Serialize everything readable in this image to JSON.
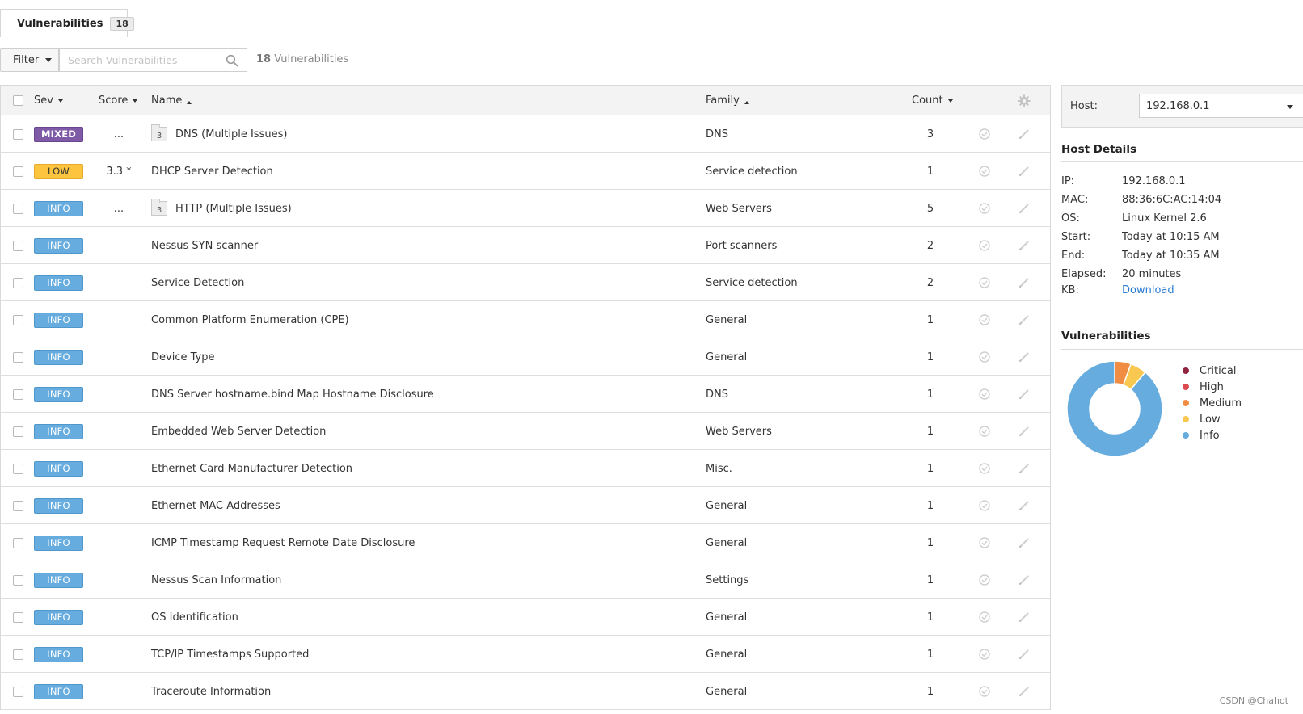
{
  "tab": {
    "label": "Vulnerabilities",
    "count": "18"
  },
  "toolbar": {
    "filter_label": "Filter",
    "search_placeholder": "Search Vulnerabilities",
    "result_count": "18",
    "result_suffix": " Vulnerabilities"
  },
  "table": {
    "headers": {
      "sev": "Sev",
      "score": "Score",
      "name": "Name",
      "family": "Family",
      "count": "Count"
    },
    "rows": [
      {
        "sev": "MIXED",
        "sev_class": "mixed",
        "score": "...",
        "group_count": "3",
        "name": "DNS (Multiple Issues)",
        "family": "DNS",
        "count": "3"
      },
      {
        "sev": "LOW",
        "sev_class": "low",
        "score": "3.3 *",
        "group_count": "",
        "name": "DHCP Server Detection",
        "family": "Service detection",
        "count": "1"
      },
      {
        "sev": "INFO",
        "sev_class": "info",
        "score": "...",
        "group_count": "3",
        "name": "HTTP (Multiple Issues)",
        "family": "Web Servers",
        "count": "5"
      },
      {
        "sev": "INFO",
        "sev_class": "info",
        "score": "",
        "group_count": "",
        "name": "Nessus SYN scanner",
        "family": "Port scanners",
        "count": "2"
      },
      {
        "sev": "INFO",
        "sev_class": "info",
        "score": "",
        "group_count": "",
        "name": "Service Detection",
        "family": "Service detection",
        "count": "2"
      },
      {
        "sev": "INFO",
        "sev_class": "info",
        "score": "",
        "group_count": "",
        "name": "Common Platform Enumeration (CPE)",
        "family": "General",
        "count": "1"
      },
      {
        "sev": "INFO",
        "sev_class": "info",
        "score": "",
        "group_count": "",
        "name": "Device Type",
        "family": "General",
        "count": "1"
      },
      {
        "sev": "INFO",
        "sev_class": "info",
        "score": "",
        "group_count": "",
        "name": "DNS Server hostname.bind Map Hostname Disclosure",
        "family": "DNS",
        "count": "1"
      },
      {
        "sev": "INFO",
        "sev_class": "info",
        "score": "",
        "group_count": "",
        "name": "Embedded Web Server Detection",
        "family": "Web Servers",
        "count": "1"
      },
      {
        "sev": "INFO",
        "sev_class": "info",
        "score": "",
        "group_count": "",
        "name": "Ethernet Card Manufacturer Detection",
        "family": "Misc.",
        "count": "1"
      },
      {
        "sev": "INFO",
        "sev_class": "info",
        "score": "",
        "group_count": "",
        "name": "Ethernet MAC Addresses",
        "family": "General",
        "count": "1"
      },
      {
        "sev": "INFO",
        "sev_class": "info",
        "score": "",
        "group_count": "",
        "name": "ICMP Timestamp Request Remote Date Disclosure",
        "family": "General",
        "count": "1"
      },
      {
        "sev": "INFO",
        "sev_class": "info",
        "score": "",
        "group_count": "",
        "name": "Nessus Scan Information",
        "family": "Settings",
        "count": "1"
      },
      {
        "sev": "INFO",
        "sev_class": "info",
        "score": "",
        "group_count": "",
        "name": "OS Identification",
        "family": "General",
        "count": "1"
      },
      {
        "sev": "INFO",
        "sev_class": "info",
        "score": "",
        "group_count": "",
        "name": "TCP/IP Timestamps Supported",
        "family": "General",
        "count": "1"
      },
      {
        "sev": "INFO",
        "sev_class": "info",
        "score": "",
        "group_count": "",
        "name": "Traceroute Information",
        "family": "General",
        "count": "1"
      }
    ]
  },
  "host": {
    "label": "Host:",
    "selected": "192.168.0.1",
    "details_title": "Host Details",
    "details": [
      {
        "key": "IP:",
        "value": "192.168.0.1"
      },
      {
        "key": "MAC:",
        "value": "88:36:6C:AC:14:04"
      },
      {
        "key": "OS:",
        "value": "Linux Kernel 2.6"
      },
      {
        "key": "Start:",
        "value": "Today at 10:15 AM"
      },
      {
        "key": "End:",
        "value": "Today at 10:35 AM"
      },
      {
        "key": "Elapsed:",
        "value": "20 minutes"
      }
    ],
    "kb_key": "KB:",
    "kb_link": "Download"
  },
  "vuln_chart": {
    "title": "Vulnerabilities",
    "chart_type": "donut",
    "legend": [
      {
        "label": "Critical",
        "color": "#91243e",
        "count": 0
      },
      {
        "label": "High",
        "color": "#dd4b50",
        "count": 0
      },
      {
        "label": "Medium",
        "color": "#f18c43",
        "count": 1
      },
      {
        "label": "Low",
        "color": "#f8c851",
        "count": 1
      },
      {
        "label": "Info",
        "color": "#67acde",
        "count": 16
      }
    ]
  },
  "watermark": "CSDN @Chahot"
}
